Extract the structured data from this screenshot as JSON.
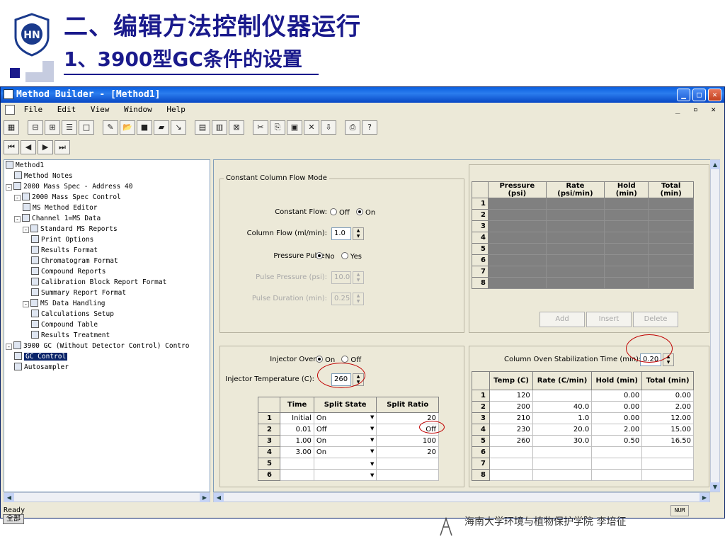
{
  "slide": {
    "title": "二、编辑方法控制仪器运行",
    "subtitle": "1、3900型GC条件的设置",
    "footer": "海南大学环境与植物保护学院   李培征"
  },
  "window": {
    "title": "Method Builder - [Method1]",
    "menu": [
      "File",
      "Edit",
      "View",
      "Window",
      "Help"
    ],
    "status": "Ready",
    "num_indicator": "NUM"
  },
  "tree": [
    {
      "label": "Method1",
      "level": 0
    },
    {
      "label": "Method Notes",
      "level": 1
    },
    {
      "label": "2000 Mass Spec - Address 40",
      "level": 0,
      "exp": "-"
    },
    {
      "label": "2000 Mass Spec Control",
      "level": 1,
      "exp": "-"
    },
    {
      "label": "MS Method Editor",
      "level": 2
    },
    {
      "label": "Channel 1=MS Data",
      "level": 1,
      "exp": "-"
    },
    {
      "label": "Standard MS Reports",
      "level": 2,
      "exp": "-"
    },
    {
      "label": "Print Options",
      "level": 3
    },
    {
      "label": "Results Format",
      "level": 3
    },
    {
      "label": "Chromatogram Format",
      "level": 3
    },
    {
      "label": "Compound Reports",
      "level": 3
    },
    {
      "label": "Calibration Block Report Format",
      "level": 3
    },
    {
      "label": "Summary Report Format",
      "level": 3
    },
    {
      "label": "MS Data Handling",
      "level": 2,
      "exp": "-"
    },
    {
      "label": "Calculations Setup",
      "level": 3
    },
    {
      "label": "Compound Table",
      "level": 3
    },
    {
      "label": "Results Treatment",
      "level": 3
    },
    {
      "label": "3900 GC (Without Detector Control) Contro",
      "level": 0,
      "exp": "-"
    },
    {
      "label": "GC Control",
      "level": 1,
      "selected": true
    },
    {
      "label": "Autosampler",
      "level": 1
    }
  ],
  "flow": {
    "group_label": "Constant Column Flow Mode",
    "constant_flow_label": "Constant Flow:",
    "off": "Off",
    "on": "On",
    "column_flow_label": "Column Flow (ml/min):",
    "column_flow_value": "1.0",
    "pressure_pulse_label": "Pressure Pulse:",
    "no": "No",
    "yes": "Yes",
    "pulse_pressure_label": "Pulse Pressure (psi):",
    "pulse_pressure_value": "10.0",
    "pulse_duration_label": "Pulse Duration (min):",
    "pulse_duration_value": "0.25"
  },
  "pressure_table": {
    "headers": [
      "Pressure (psi)",
      "Rate (psi/min)",
      "Hold (min)",
      "Total (min)"
    ],
    "rows": [
      "1",
      "2",
      "3",
      "4",
      "5",
      "6",
      "7",
      "8"
    ],
    "buttons": [
      "Add",
      "Insert",
      "Delete"
    ]
  },
  "injector": {
    "oven_label": "Injector Oven:",
    "on": "On",
    "off": "Off",
    "temp_label": "Injector Temperature (C):",
    "temp_value": "260",
    "split_headers": [
      "Time",
      "Split State",
      "Split Ratio"
    ],
    "split_rows": [
      {
        "n": "1",
        "time": "Initial",
        "state": "On",
        "ratio": "20"
      },
      {
        "n": "2",
        "time": "0.01",
        "state": "Off",
        "ratio": "Off"
      },
      {
        "n": "3",
        "time": "1.00",
        "state": "On",
        "ratio": "100"
      },
      {
        "n": "4",
        "time": "3.00",
        "state": "On",
        "ratio": "20"
      },
      {
        "n": "5",
        "time": "",
        "state": "",
        "ratio": ""
      },
      {
        "n": "6",
        "time": "",
        "state": "",
        "ratio": ""
      }
    ]
  },
  "oven": {
    "stab_label": "Column Oven Stabilization Time (min):",
    "stab_value": "0.20",
    "headers": [
      "Temp (C)",
      "Rate (C/min)",
      "Hold (min)",
      "Total (min)"
    ],
    "rows": [
      {
        "n": "1",
        "temp": "120",
        "rate": "",
        "hold": "0.00",
        "total": "0.00"
      },
      {
        "n": "2",
        "temp": "200",
        "rate": "40.0",
        "hold": "0.00",
        "total": "2.00"
      },
      {
        "n": "3",
        "temp": "210",
        "rate": "1.0",
        "hold": "0.00",
        "total": "12.00"
      },
      {
        "n": "4",
        "temp": "230",
        "rate": "20.0",
        "hold": "2.00",
        "total": "15.00"
      },
      {
        "n": "5",
        "temp": "260",
        "rate": "30.0",
        "hold": "0.50",
        "total": "16.50"
      },
      {
        "n": "6",
        "temp": "",
        "rate": "",
        "hold": "",
        "total": ""
      },
      {
        "n": "7",
        "temp": "",
        "rate": "",
        "hold": "",
        "total": ""
      },
      {
        "n": "8",
        "temp": "",
        "rate": "",
        "hold": "",
        "total": ""
      }
    ]
  },
  "taskbar": {
    "item": "全部"
  },
  "colors": {
    "accent": "#1a1a8c",
    "titlebar": "#0a5fe0",
    "highlight": "#c00000"
  }
}
